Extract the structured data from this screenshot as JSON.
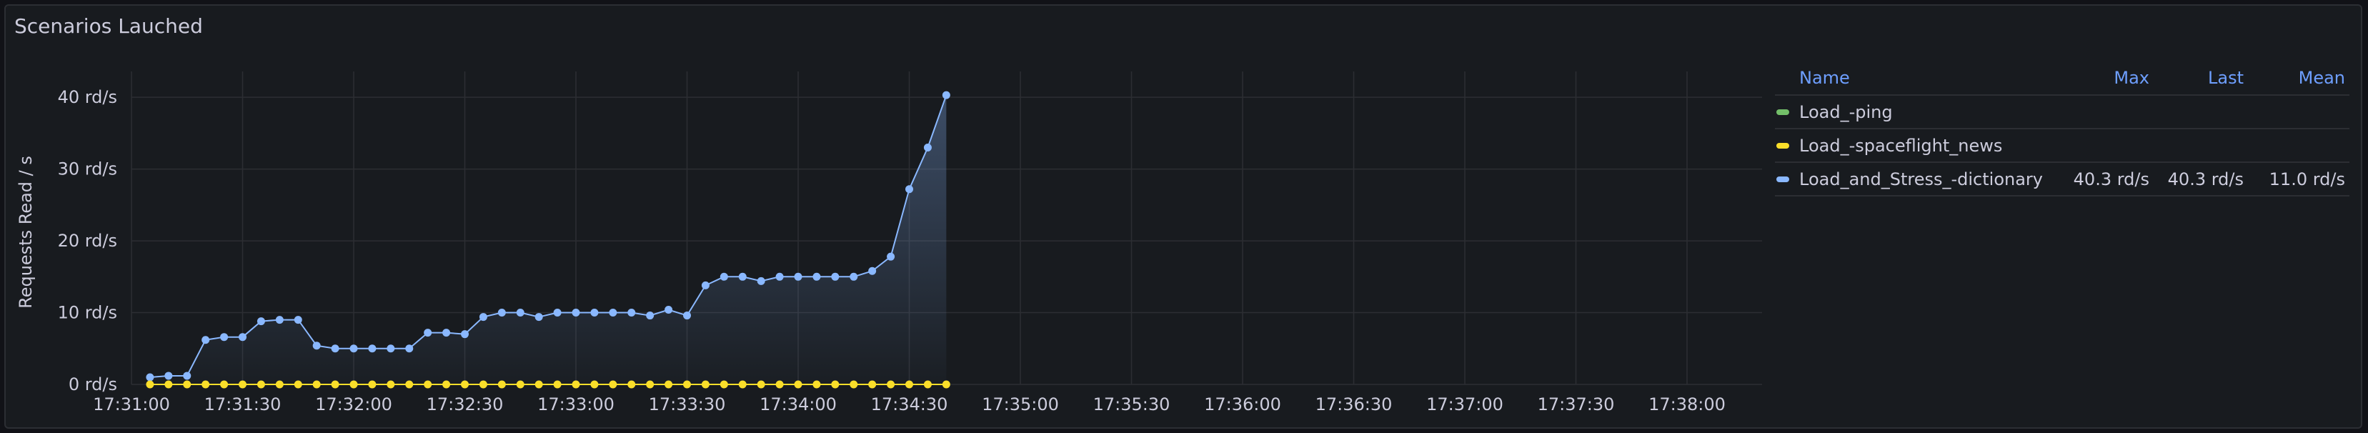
{
  "panel": {
    "title": "Scenarios Lauched"
  },
  "colors": {
    "background": "#181b1f",
    "grid": "#2c2e33",
    "text": "#ccccdc",
    "header": "#6e9fff",
    "series_blue": "#8ab8ff",
    "series_yellow": "#fade2a",
    "series_green": "#73bf69"
  },
  "legend": {
    "headers": {
      "name": "Name",
      "max": "Max",
      "last": "Last",
      "mean": "Mean"
    },
    "rows": [
      {
        "name": "Load_-ping",
        "color": "#73bf69",
        "max": "",
        "last": "",
        "mean": ""
      },
      {
        "name": "Load_-spaceflight_news",
        "color": "#fade2a",
        "max": "",
        "last": "",
        "mean": ""
      },
      {
        "name": "Load_and_Stress_-dictionary",
        "color": "#8ab8ff",
        "max": "40.3 rd/s",
        "last": "40.3 rd/s",
        "mean": "11.0 rd/s"
      }
    ]
  },
  "chart_data": {
    "type": "line",
    "title": "Scenarios Lauched",
    "ylabel": "Requests Read / s",
    "xlabel": "",
    "ylim": [
      0,
      43.6
    ],
    "y_ticks": [
      0,
      10,
      20,
      30,
      40
    ],
    "y_tick_labels": [
      "0 rd/s",
      "10 rd/s",
      "20 rd/s",
      "30 rd/s",
      "40 rd/s"
    ],
    "x_tick_labels": [
      "17:31:00",
      "17:31:30",
      "17:32:00",
      "17:32:30",
      "17:33:00",
      "17:33:30",
      "17:34:00",
      "17:34:30",
      "17:35:00",
      "17:35:30",
      "17:36:00",
      "17:36:30",
      "17:37:00",
      "17:37:30",
      "17:38:00"
    ],
    "grid": true,
    "legend_position": "right",
    "x": [
      "17:31:05",
      "17:31:10",
      "17:31:15",
      "17:31:20",
      "17:31:25",
      "17:31:30",
      "17:31:35",
      "17:31:40",
      "17:31:45",
      "17:31:50",
      "17:31:55",
      "17:32:00",
      "17:32:05",
      "17:32:10",
      "17:32:15",
      "17:32:20",
      "17:32:25",
      "17:32:30",
      "17:32:35",
      "17:32:40",
      "17:32:45",
      "17:32:50",
      "17:32:55",
      "17:33:00",
      "17:33:05",
      "17:33:10",
      "17:33:15",
      "17:33:20",
      "17:33:25",
      "17:33:30",
      "17:33:35",
      "17:33:40",
      "17:33:45",
      "17:33:50",
      "17:33:55",
      "17:34:00",
      "17:34:05",
      "17:34:10",
      "17:34:15",
      "17:34:20",
      "17:34:25",
      "17:34:30",
      "17:34:35",
      "17:34:40",
      "17:34:45"
    ],
    "series": [
      {
        "name": "Load_and_Stress_-dictionary",
        "color": "#8ab8ff",
        "fill": true,
        "values": [
          1.0,
          1.2,
          1.2,
          6.2,
          6.6,
          6.6,
          8.8,
          9.0,
          9.0,
          5.4,
          5.0,
          5.0,
          5.0,
          5.0,
          5.0,
          7.2,
          7.2,
          7.0,
          9.4,
          10.0,
          10.0,
          9.4,
          10.0,
          10.0,
          10.0,
          10.0,
          10.0,
          9.6,
          10.4,
          9.6,
          13.8,
          15.0,
          15.0,
          14.4,
          15.0,
          15.0,
          15.0,
          15.0,
          15.0,
          15.8,
          17.8,
          27.2,
          33.0,
          40.3
        ]
      },
      {
        "name": "Load_-spaceflight_news",
        "color": "#fade2a",
        "fill": false,
        "values": [
          0,
          0,
          0,
          0,
          0,
          0,
          0,
          0,
          0,
          0,
          0,
          0,
          0,
          0,
          0,
          0,
          0,
          0,
          0,
          0,
          0,
          0,
          0,
          0,
          0,
          0,
          0,
          0,
          0,
          0,
          0,
          0,
          0,
          0,
          0,
          0,
          0,
          0,
          0,
          0,
          0,
          0,
          0,
          0
        ]
      }
    ]
  }
}
